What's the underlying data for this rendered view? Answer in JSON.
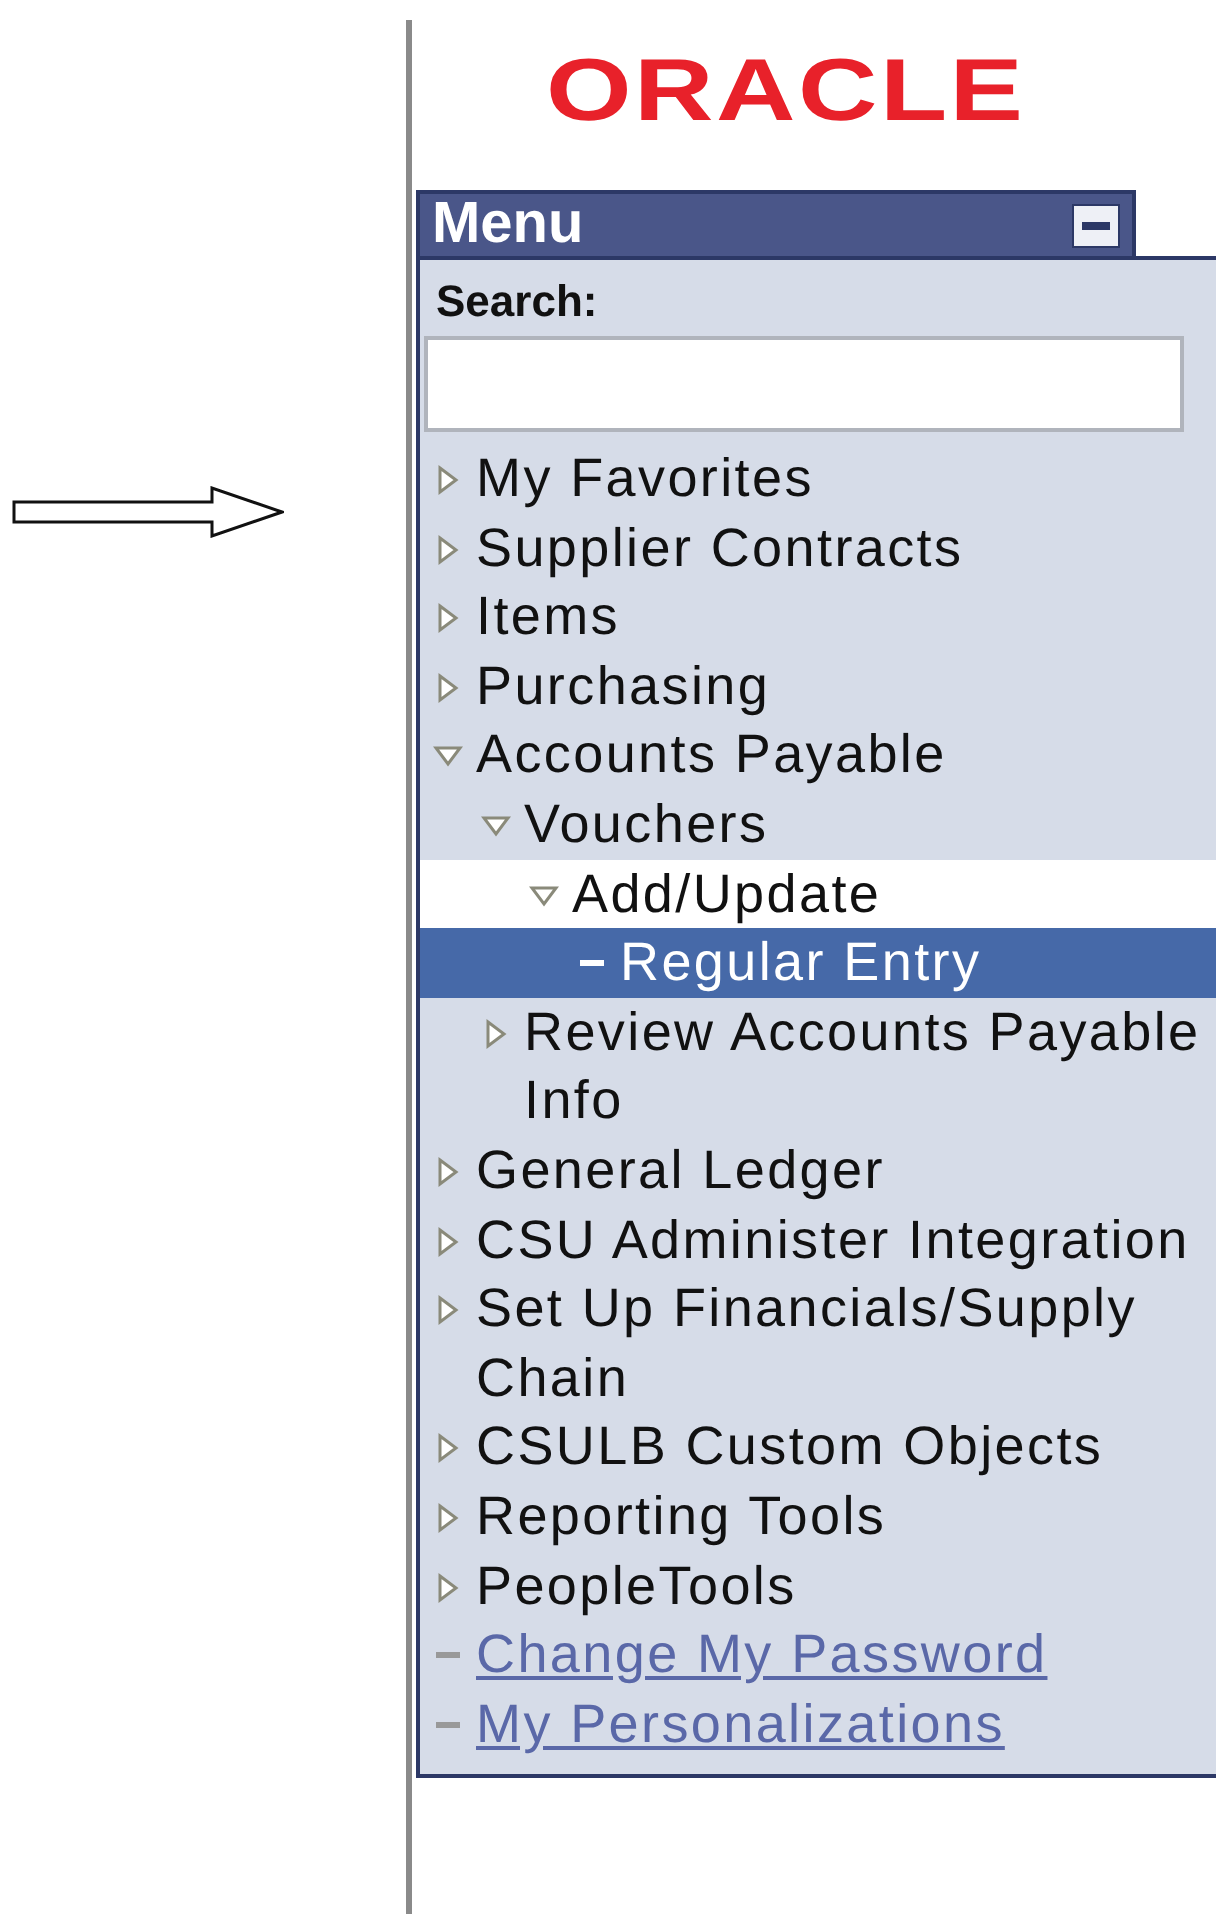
{
  "logo": {
    "text": "ORACLE"
  },
  "menu": {
    "title": "Menu",
    "search_label": "Search:",
    "items": [
      {
        "label": "My Favorites",
        "kind": "folder",
        "expanded": false,
        "selected": false,
        "active": false
      },
      {
        "label": "Supplier Contracts",
        "kind": "folder",
        "expanded": false,
        "selected": false,
        "active": false
      },
      {
        "label": "Items",
        "kind": "folder",
        "expanded": false,
        "selected": false,
        "active": false
      },
      {
        "label": "Purchasing",
        "kind": "folder",
        "expanded": false,
        "selected": false,
        "active": false
      },
      {
        "label": "Accounts Payable",
        "kind": "folder",
        "expanded": true,
        "selected": false,
        "active": false,
        "children": [
          {
            "label": "Vouchers",
            "kind": "folder",
            "expanded": true,
            "selected": false,
            "active": false,
            "children": [
              {
                "label": "Add/Update",
                "kind": "folder",
                "expanded": true,
                "selected": false,
                "active": true,
                "children": [
                  {
                    "label": "Regular Entry",
                    "kind": "page",
                    "selected": true,
                    "active": false
                  }
                ]
              }
            ]
          },
          {
            "label": "Review Accounts Payable Info",
            "kind": "folder",
            "expanded": false,
            "selected": false,
            "active": false
          }
        ]
      },
      {
        "label": "General Ledger",
        "kind": "folder",
        "expanded": false,
        "selected": false,
        "active": false
      },
      {
        "label": "CSU Administer Integration",
        "kind": "folder",
        "expanded": false,
        "selected": false,
        "active": false
      },
      {
        "label": "Set Up Financials/Supply Chain",
        "kind": "folder",
        "expanded": false,
        "selected": false,
        "active": false
      },
      {
        "label": "CSULB Custom Objects",
        "kind": "folder",
        "expanded": false,
        "selected": false,
        "active": false
      },
      {
        "label": "Reporting Tools",
        "kind": "folder",
        "expanded": false,
        "selected": false,
        "active": false
      },
      {
        "label": "PeopleTools",
        "kind": "folder",
        "expanded": false,
        "selected": false,
        "active": false
      },
      {
        "label": "Change My Password",
        "kind": "link",
        "selected": false,
        "active": false
      },
      {
        "label": "My Personalizations",
        "kind": "link",
        "selected": false,
        "active": false
      }
    ]
  }
}
